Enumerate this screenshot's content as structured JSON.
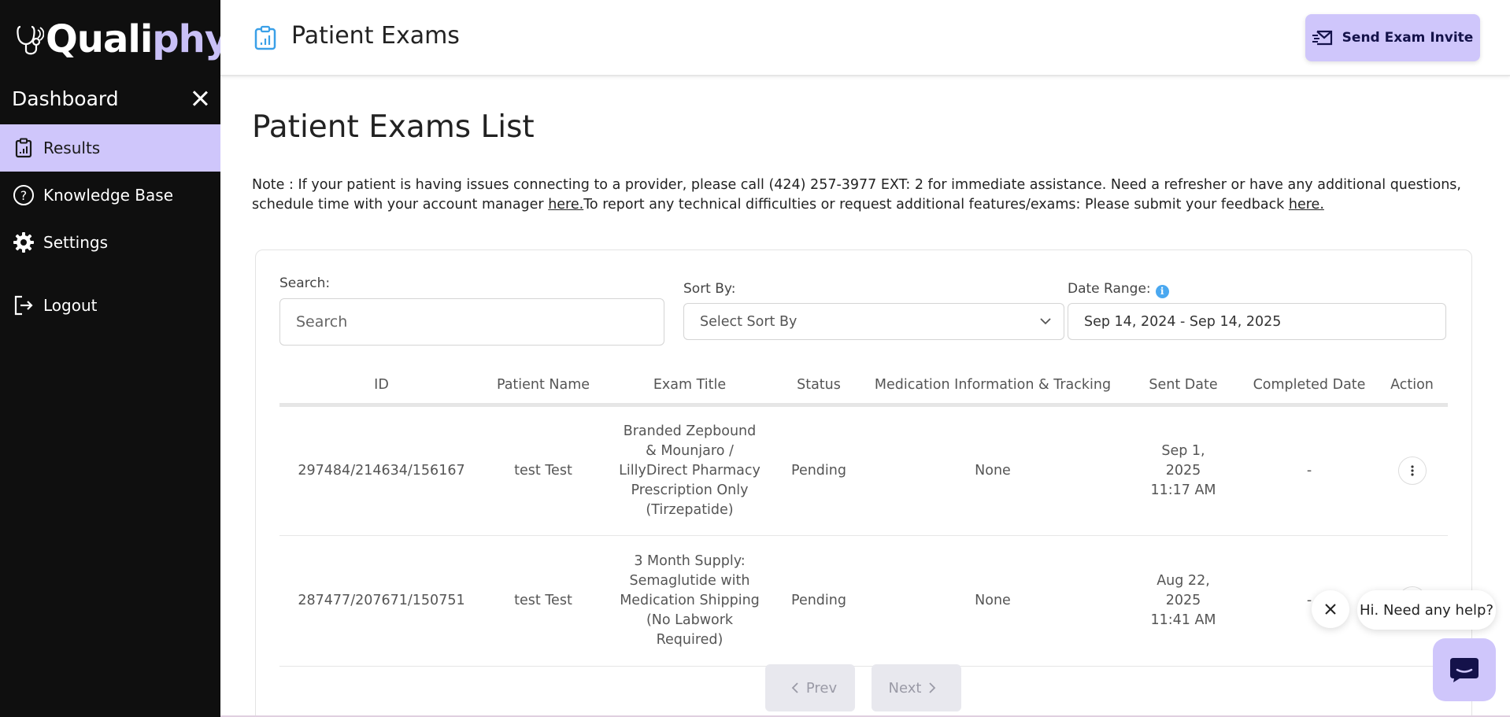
{
  "brand": {
    "logo_part1": "Quali",
    "logo_part2": "phy"
  },
  "sidebar": {
    "title": "Dashboard",
    "items": [
      {
        "label": "Results",
        "icon": "clipboard-icon",
        "active": true
      },
      {
        "label": "Knowledge Base",
        "icon": "question-circle-icon"
      },
      {
        "label": "Settings",
        "icon": "gear-icon"
      },
      {
        "label": "Logout",
        "icon": "logout-icon"
      }
    ]
  },
  "header": {
    "title": "Patient Exams",
    "invite_button": "Send Exam Invite"
  },
  "main": {
    "title": "Patient Exams List",
    "note_prefix": "Note : If your patient is having issues connecting to a provider, please call (424) 257-3977 EXT: 2 for immediate assistance. Need a refresher or have any additional questions, schedule time with your account manager ",
    "note_link1": "here.",
    "note_middle": "To report any technical difficulties or request additional features/exams: Please submit your feedback ",
    "note_link2": "here."
  },
  "filters": {
    "search_label": "Search:",
    "search_placeholder": "Search",
    "sort_label": "Sort By:",
    "sort_value": "Select Sort By",
    "date_label": "Date Range:",
    "date_value": "Sep 14, 2024 - Sep 14, 2025"
  },
  "table": {
    "columns": [
      "ID",
      "Patient Name",
      "Exam Title",
      "Status",
      "Medication Information & Tracking",
      "Sent Date",
      "Completed Date",
      "Action"
    ],
    "rows": [
      {
        "id": "297484/214634/156167",
        "patient": "test Test",
        "exam_title": "Branded Zepbound & Mounjaro / LillyDirect Pharmacy Prescription Only (Tirzepatide)",
        "status": "Pending",
        "medication": "None",
        "sent_date": "Sep 1, 2025 11:17 AM",
        "completed_date": "-"
      },
      {
        "id": "287477/207671/150751",
        "patient": "test Test",
        "exam_title": "3 Month Supply: Semaglutide with Medication Shipping (No Labwork Required)",
        "status": "Pending",
        "medication": "None",
        "sent_date": "Aug 22, 2025 11:41 AM",
        "completed_date": "-"
      }
    ]
  },
  "pagination": {
    "prev": "Prev",
    "next": "Next"
  },
  "chat": {
    "message": "Hi. Need any help?"
  },
  "colors": {
    "accent": "#cfc6fb",
    "sidebar_bg": "#0f0f0f",
    "info": "#4aa8f0"
  }
}
